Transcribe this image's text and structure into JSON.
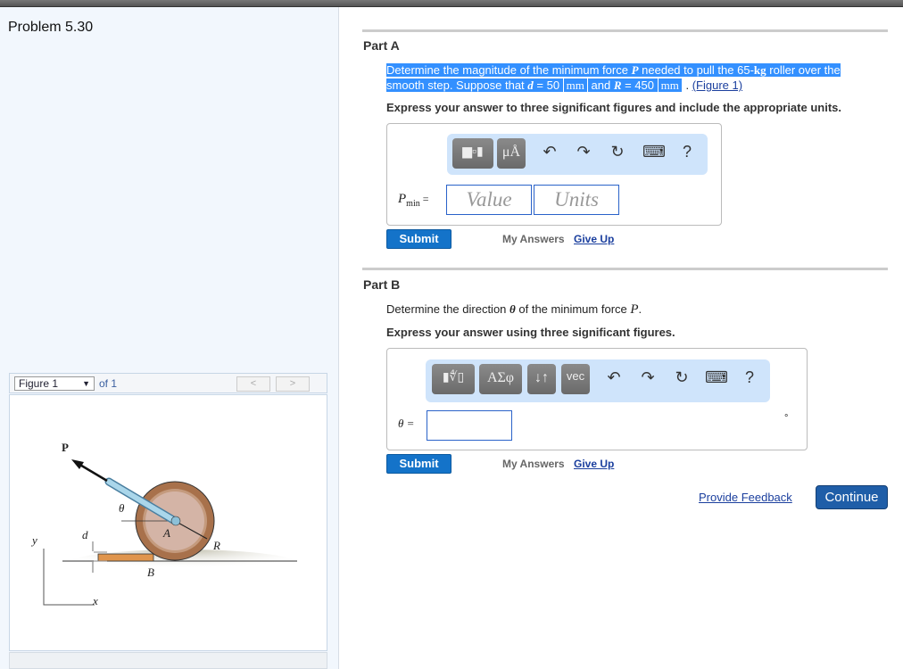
{
  "problem_title": "Problem 5.30",
  "figure": {
    "selector": "Figure 1",
    "of": "of 1",
    "prev": "<",
    "next": ">",
    "labels": {
      "P": "P",
      "theta": "θ",
      "A": "A",
      "R": "R",
      "B": "B",
      "d": "d",
      "y": "y",
      "x": "x"
    }
  },
  "partA": {
    "title": "Part A",
    "q1": "Determine the magnitude of the minimum force ",
    "q_P": "P",
    "q2": " needed to pull the 65-",
    "q_kg": "kg",
    "q3": " roller over the smooth step. Suppose that ",
    "q_d": "d",
    "q4": " = 50 ",
    "q_mm1": "mm",
    "q5": " and ",
    "q_R": "R",
    "q6": " = 450 ",
    "q_mm2": "mm",
    "q7": " . ",
    "fig_link": "(Figure 1)",
    "instruction": "Express your answer to three significant figures and include the appropriate units.",
    "toolbar": {
      "b1": "▆▫▮",
      "b2": "μÅ",
      "undo": "↶",
      "redo": "↷",
      "reset": "↻",
      "keyboard": "⌨",
      "help": "?"
    },
    "label": "P",
    "label_sub": "min",
    "eq": " =",
    "value_placeholder": "Value",
    "units_placeholder": "Units",
    "submit": "Submit",
    "my_answers": "My Answers",
    "give_up": "Give Up"
  },
  "partB": {
    "title": "Part B",
    "q1": "Determine the direction ",
    "q_theta": "θ",
    "q2": " of the minimum force ",
    "q_P": "P",
    "q3": ".",
    "instruction": "Express your answer using three significant figures.",
    "toolbar": {
      "b1": "▮∜▯",
      "b2": "ΑΣφ",
      "b3": "↓↑",
      "b4": "vec",
      "undo": "↶",
      "redo": "↷",
      "reset": "↻",
      "keyboard": "⌨",
      "help": "?"
    },
    "label": "θ =",
    "unit": "°",
    "submit": "Submit",
    "my_answers": "My Answers",
    "give_up": "Give Up"
  },
  "footer": {
    "feedback": "Provide Feedback",
    "continue": "Continue"
  }
}
